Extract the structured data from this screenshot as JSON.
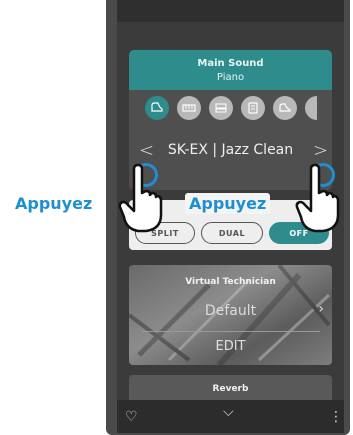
{
  "main_sound": {
    "title": "Main Sound",
    "subtitle": "Piano",
    "selected_sound": "SK-EX | Jazz Clean",
    "prev_arrow": "<",
    "next_arrow": ">",
    "categories": [
      {
        "icon": "grand-piano-icon",
        "active": true
      },
      {
        "icon": "electric-piano-icon",
        "active": false
      },
      {
        "icon": "organ-icon",
        "active": false
      },
      {
        "icon": "harpsichord-icon",
        "active": false
      },
      {
        "icon": "strings-icon",
        "active": false
      }
    ]
  },
  "modes": {
    "split": "SPLIT",
    "dual": "DUAL",
    "off": "OFF"
  },
  "virtual_technician": {
    "title": "Virtual Technician",
    "value": "Default",
    "edit": "EDIT"
  },
  "reverb": {
    "title": "Reverb"
  },
  "annotations": {
    "left_label": "Appuyez",
    "right_label": "Appuyez"
  },
  "colors": {
    "accent": "#2f8c8c",
    "callout": "#1e8fd2"
  }
}
